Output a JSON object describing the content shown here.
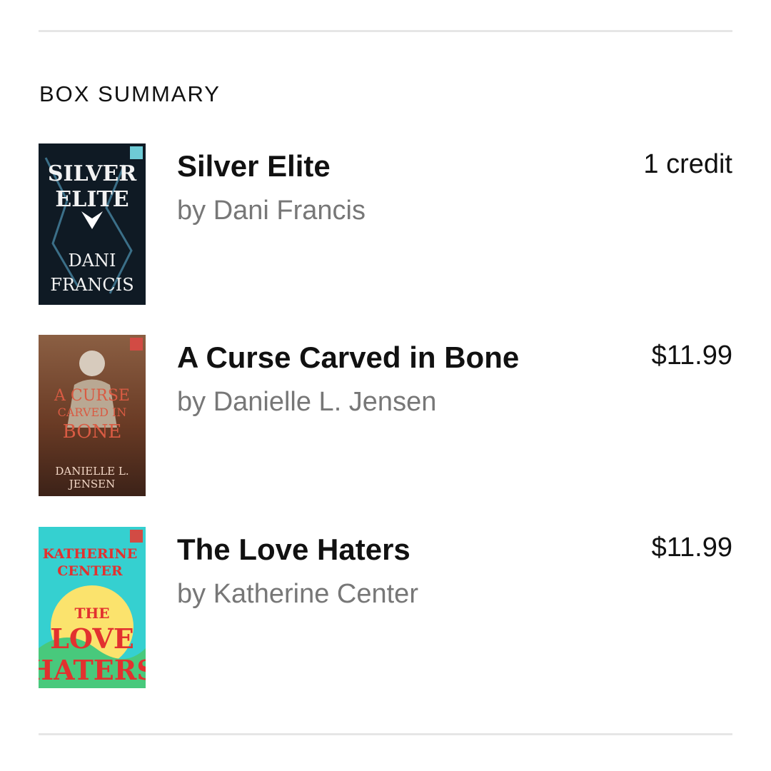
{
  "section": {
    "title": "BOX SUMMARY"
  },
  "items": [
    {
      "title": "Silver Elite",
      "author": "by Dani Francis",
      "price": "1 credit",
      "cover": {
        "title_lines": [
          "SILVER",
          "ELITE"
        ],
        "author_lines": [
          "DANI",
          "FRANCIS"
        ],
        "colors": {
          "bg": "#0f1a24",
          "accent": "#3b6f88",
          "text": "#f2f2f2"
        }
      }
    },
    {
      "title": "A Curse Carved in Bone",
      "author": "by Danielle L. Jensen",
      "price": "$11.99",
      "cover": {
        "title_lines": [
          "A CURSE",
          "CARVED IN",
          "BONE"
        ],
        "author_lines": [
          "DANIELLE L.",
          "JENSEN"
        ],
        "colors": {
          "bg": "#5b3522",
          "accent": "#b45a34",
          "text": "#f2d7c6"
        }
      }
    },
    {
      "title": "The Love Haters",
      "author": "by Katherine Center",
      "price": "$11.99",
      "cover": {
        "title_lines": [
          "THE",
          "LOVE",
          "HATERS"
        ],
        "author_lines": [
          "KATHERINE",
          "CENTER"
        ],
        "colors": {
          "bg": "#35d0d0",
          "accent": "#fbe36d",
          "text": "#e2312f"
        }
      }
    }
  ]
}
